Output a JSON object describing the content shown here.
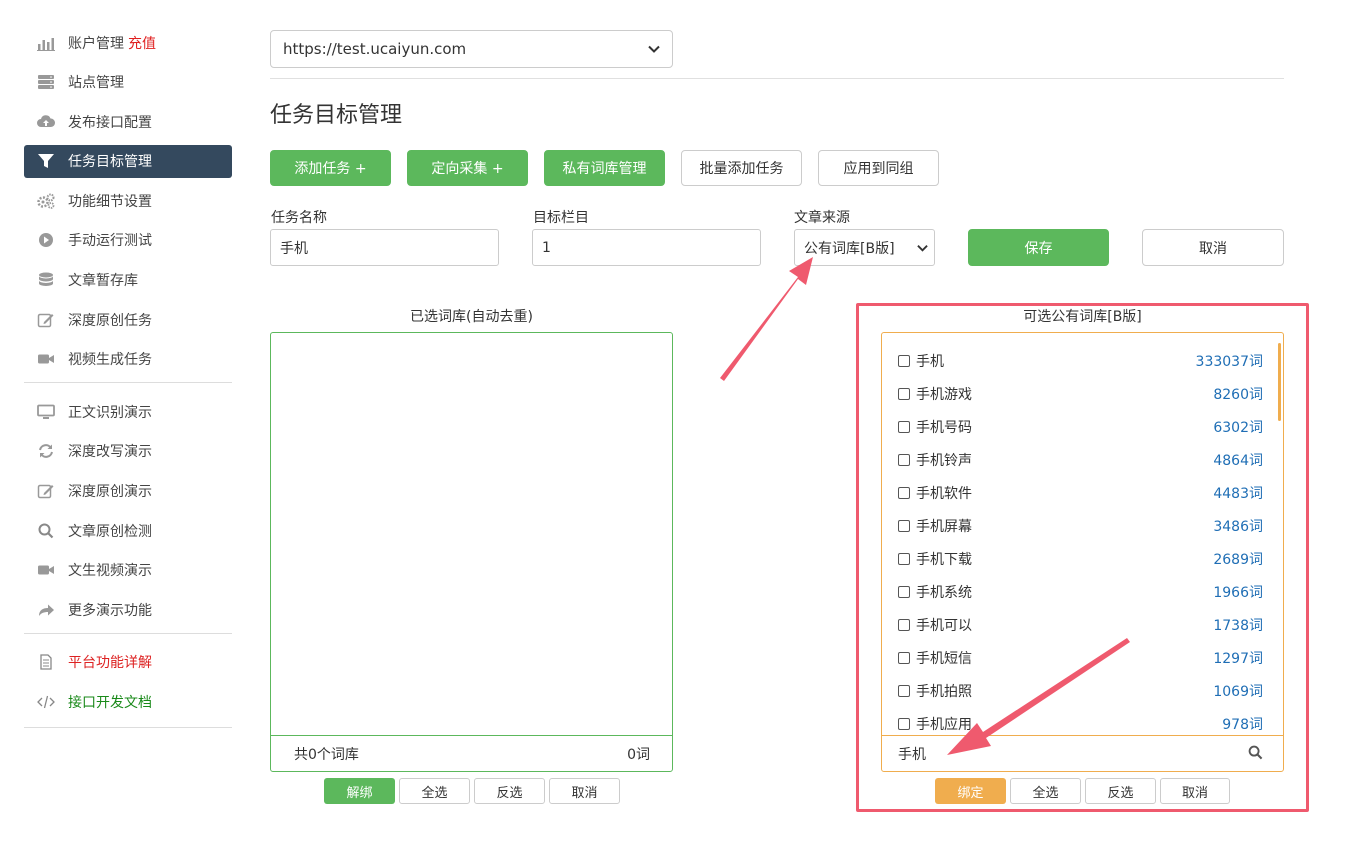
{
  "sidebar": {
    "items": [
      {
        "label": "账户管理",
        "extra": "充值",
        "icon": "bar-chart-icon"
      },
      {
        "label": "站点管理",
        "icon": "server-icon"
      },
      {
        "label": "发布接口配置",
        "icon": "cloud-upload-icon"
      },
      {
        "label": "任务目标管理",
        "icon": "filter-icon"
      },
      {
        "label": "功能细节设置",
        "icon": "gears-icon"
      },
      {
        "label": "手动运行测试",
        "icon": "play-circle-icon"
      },
      {
        "label": "文章暂存库",
        "icon": "database-icon"
      },
      {
        "label": "深度原创任务",
        "icon": "edit-icon"
      },
      {
        "label": "视频生成任务",
        "icon": "video-icon"
      }
    ],
    "demo_items": [
      {
        "label": "正文识别演示",
        "icon": "monitor-icon"
      },
      {
        "label": "深度改写演示",
        "icon": "refresh-icon"
      },
      {
        "label": "深度原创演示",
        "icon": "edit-icon"
      },
      {
        "label": "文章原创检测",
        "icon": "search-icon"
      },
      {
        "label": "文生视频演示",
        "icon": "video-icon"
      },
      {
        "label": "更多演示功能",
        "icon": "share-arrow-icon"
      }
    ],
    "doc_items": [
      {
        "label": "平台功能详解",
        "icon": "document-icon"
      },
      {
        "label": "接口开发文档",
        "icon": "code-icon"
      }
    ]
  },
  "site_select": {
    "value": "https://test.ucaiyun.com"
  },
  "page_title": "任务目标管理",
  "toolbar": {
    "add_task": "添加任务 +",
    "directed_collect": "定向采集 +",
    "private_lib": "私有词库管理",
    "batch_add": "批量添加任务",
    "apply_group": "应用到同组"
  },
  "form": {
    "task_name_label": "任务名称",
    "task_name_value": "手机",
    "target_label": "目标栏目",
    "target_value": "1",
    "source_label": "文章来源",
    "source_value": "公有词库[B版]",
    "save": "保存",
    "cancel": "取消"
  },
  "selected_panel": {
    "title": "已选词库(自动去重)",
    "footer_count": "共0个词库",
    "footer_words": "0词",
    "btn_unbind": "解绑",
    "btn_all": "全选",
    "btn_invert": "反选",
    "btn_cancel": "取消"
  },
  "available_panel": {
    "title": "可选公有词库[B版]",
    "items": [
      {
        "name": "手机",
        "count": "333037词"
      },
      {
        "name": "手机游戏",
        "count": "8260词"
      },
      {
        "name": "手机号码",
        "count": "6302词"
      },
      {
        "name": "手机铃声",
        "count": "4864词"
      },
      {
        "name": "手机软件",
        "count": "4483词"
      },
      {
        "name": "手机屏幕",
        "count": "3486词"
      },
      {
        "name": "手机下载",
        "count": "2689词"
      },
      {
        "name": "手机系统",
        "count": "1966词"
      },
      {
        "name": "手机可以",
        "count": "1738词"
      },
      {
        "name": "手机短信",
        "count": "1297词"
      },
      {
        "name": "手机拍照",
        "count": "1069词"
      },
      {
        "name": "手机应用",
        "count": "978词"
      }
    ],
    "search_value": "手机",
    "btn_bind": "绑定",
    "btn_all": "全选",
    "btn_invert": "反选",
    "btn_cancel": "取消"
  },
  "colors": {
    "accent_green": "#5cb85c",
    "accent_orange": "#f0ad4e",
    "sidebar_active": "#34495e",
    "annotation_red": "#ef5a6e",
    "count_blue": "#1f6eb5"
  }
}
